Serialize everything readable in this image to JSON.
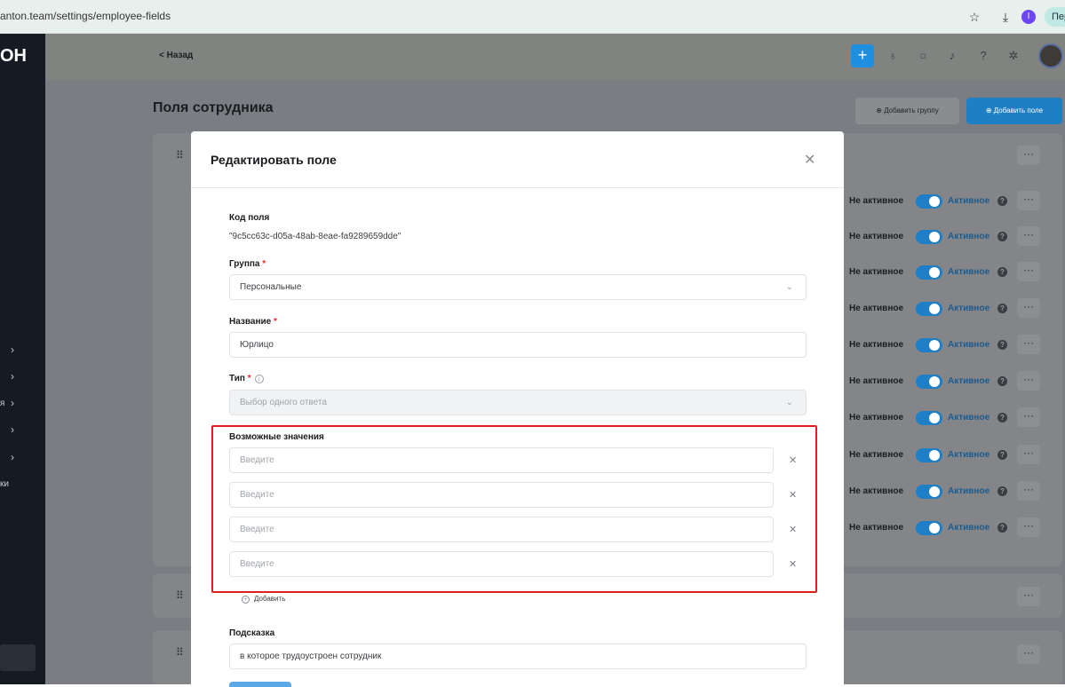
{
  "browser": {
    "url": "anton.team/settings/employee-fields",
    "ext_badge": "I",
    "profile_label": "Пер"
  },
  "sidebar": {
    "logo": "ОН",
    "fragments": [
      "я",
      "ки"
    ]
  },
  "topbar": {
    "back_label": "< Назад",
    "add_icon": "+"
  },
  "page": {
    "title": "Поля сотрудника",
    "add_group_label": "⊕ Добавить группу",
    "add_field_label": "⊕ Добавить поле"
  },
  "rows": {
    "inactive_label": "Не активное",
    "active_label": "Активное",
    "count": 10
  },
  "modal": {
    "title": "Редактировать поле",
    "code_label": "Код поля",
    "code_value": "\"9c5cc63c-d05a-48ab-8eae-fa9289659dde\"",
    "group_label": "Группа",
    "group_value": "Персональные",
    "name_label": "Название",
    "name_value": "Юрлицо",
    "type_label": "Тип",
    "type_value": "Выбор одного ответа",
    "values_label": "Возможные значения",
    "values_placeholder": "Введите",
    "add_label": "Добавить",
    "hint_label": "Подсказка",
    "hint_value": "в которое трудоустроен сотрудник"
  },
  "colors": {
    "accent": "#1f7fc6",
    "highlight": "#e01f1f"
  }
}
